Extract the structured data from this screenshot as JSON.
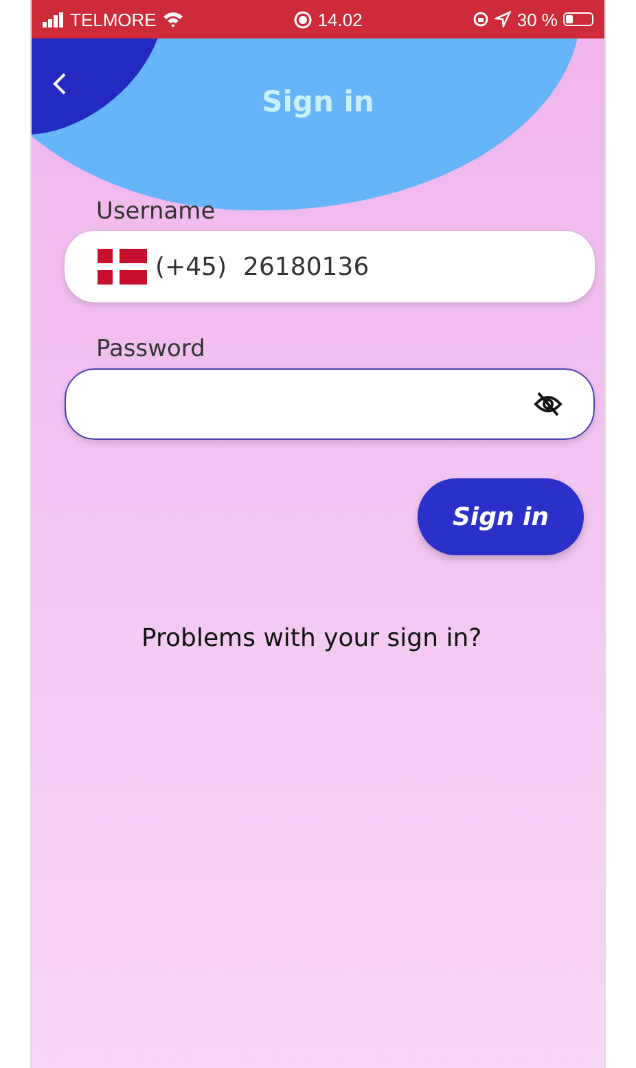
{
  "status_bar": {
    "carrier": "TELMORE",
    "time": "14.02",
    "battery": "30 %"
  },
  "header": {
    "title": "Sign in"
  },
  "username": {
    "label": "Username",
    "country_code": "(+45)",
    "value": "26180136"
  },
  "password": {
    "label": "Password"
  },
  "sign_in_button": "Sign in",
  "help_link": "Problems with your sign in?"
}
